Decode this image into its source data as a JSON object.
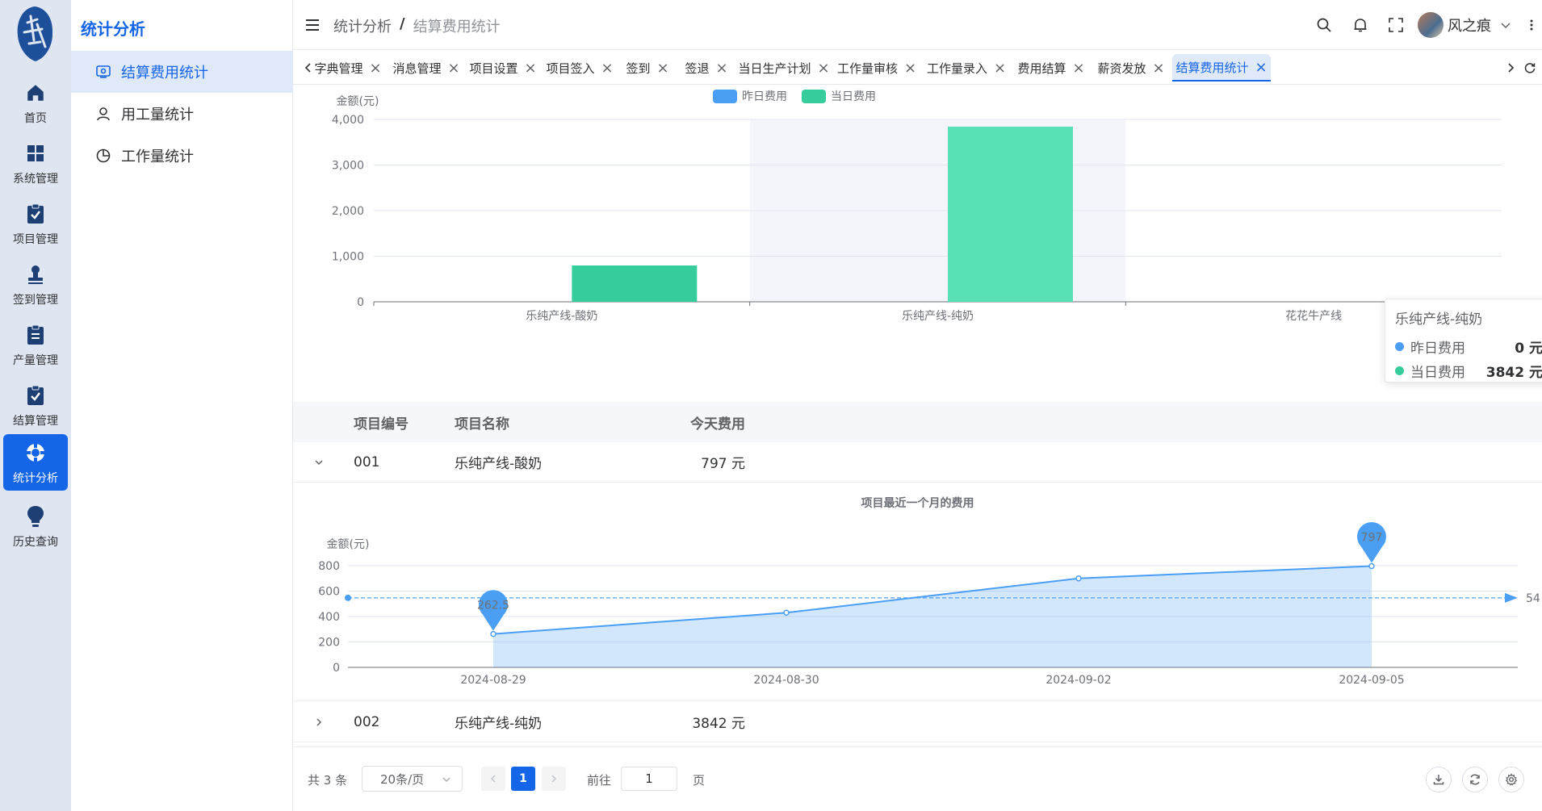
{
  "rail": {
    "items": [
      {
        "label": "首页",
        "icon": "home-icon"
      },
      {
        "label": "系统管理",
        "icon": "grid-icon"
      },
      {
        "label": "项目管理",
        "icon": "clipboard-check-icon"
      },
      {
        "label": "签到管理",
        "icon": "stamp-icon"
      },
      {
        "label": "产量管理",
        "icon": "clipboard-list-icon"
      },
      {
        "label": "结算管理",
        "icon": "clipboard-check-icon"
      },
      {
        "label": "统计分析",
        "icon": "lifebuoy-icon"
      },
      {
        "label": "历史查询",
        "icon": "lightbulb-icon"
      }
    ],
    "active": "统计分析"
  },
  "submenu": {
    "title": "统计分析",
    "items": [
      {
        "label": "结算费用统计",
        "icon": "monitor-icon"
      },
      {
        "label": "用工量统计",
        "icon": "user-icon"
      },
      {
        "label": "工作量统计",
        "icon": "pie-chart-icon"
      }
    ]
  },
  "header": {
    "breadcrumb": [
      "统计分析",
      "结算费用统计"
    ],
    "breadcrumb_sep": "/",
    "username": "风之痕"
  },
  "tabs": {
    "items": [
      "字典管理",
      "消息管理",
      "项目设置",
      "项目签入",
      "签到",
      "签退",
      "当日生产计划",
      "工作量审核",
      "工作量录入",
      "费用结算",
      "薪资发放",
      "结算费用统计"
    ],
    "active": "结算费用统计",
    "close_glyph": "×"
  },
  "bar_chart": {
    "colors": {
      "yesterday": "#4a9ff5",
      "today": "#36cc9c",
      "today_hover": "#5ae0b6"
    },
    "tooltip": {
      "title": "乐纯产线-纯奶",
      "rows": [
        {
          "name": "昨日费用",
          "value": "0 元",
          "color": "#4a9ff5"
        },
        {
          "name": "当日费用",
          "value": "3842 元",
          "color": "#36cc9c"
        }
      ]
    }
  },
  "chart_data": [
    {
      "type": "bar",
      "ylabel": "金额(元)",
      "ylim": [
        0,
        4000
      ],
      "yticks": [
        "0",
        "1,000",
        "2,000",
        "3,000",
        "4,000"
      ],
      "categories": [
        "乐纯产线-酸奶",
        "乐纯产线-纯奶",
        "花花牛产线"
      ],
      "series": [
        {
          "name": "昨日费用",
          "values": [
            0,
            0,
            0
          ]
        },
        {
          "name": "当日费用",
          "values": [
            797,
            3842,
            0
          ]
        }
      ],
      "legend": "top-center",
      "grid": true
    },
    {
      "type": "area",
      "title": "项目最近一个月的费用",
      "ylabel": "金额(元)",
      "ylim": [
        0,
        800
      ],
      "yticks": [
        "0",
        "200",
        "400",
        "600",
        "800"
      ],
      "x": [
        "2024-08-29",
        "2024-08-30",
        "2024-09-02",
        "2024-09-05"
      ],
      "values": [
        262.5,
        430,
        700,
        797
      ],
      "markpoints": [
        {
          "label": "262.5",
          "index": 0
        },
        {
          "label": "797",
          "index": 3
        }
      ],
      "markline": {
        "value": 547,
        "label": "54"
      },
      "grid": true
    }
  ],
  "table": {
    "headers": {
      "code": "项目编号",
      "name": "项目名称",
      "fee": "今天费用"
    },
    "rows": [
      {
        "code": "001",
        "name": "乐纯产线-酸奶",
        "fee": "797 元",
        "expanded": true
      },
      {
        "code": "002",
        "name": "乐纯产线-纯奶",
        "fee": "3842 元",
        "expanded": false
      }
    ]
  },
  "pagination": {
    "total": "共 3 条",
    "page_size": "20条/页",
    "current": "1",
    "goto_label": "前往",
    "goto_value": "1",
    "page_suffix": "页"
  }
}
